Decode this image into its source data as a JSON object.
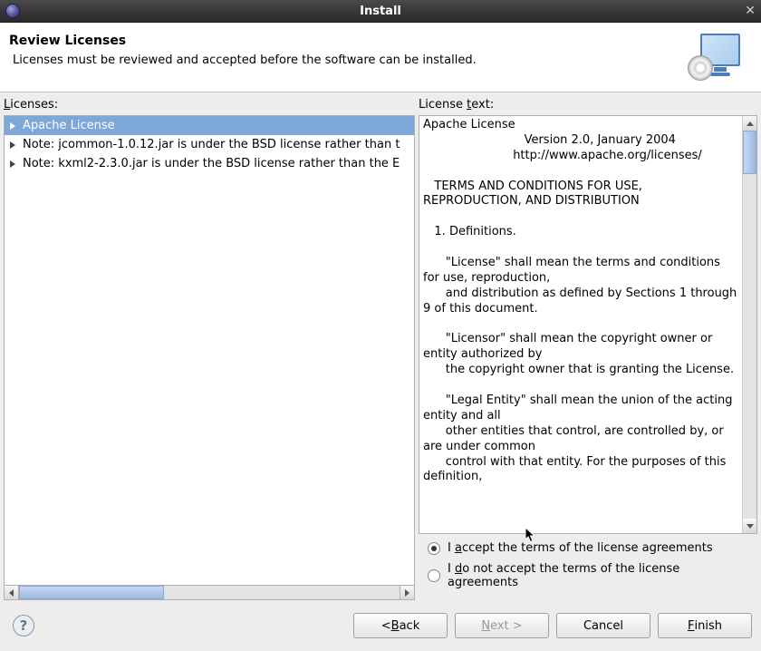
{
  "titlebar": {
    "title": "Install"
  },
  "header": {
    "title": "Review Licenses",
    "subtitle": "Licenses must be reviewed and accepted before the software can be installed."
  },
  "labels": {
    "licenses": "icenses:",
    "licenses_first": "L",
    "license_text": "License ",
    "license_text_u": "t",
    "license_text_rest": "ext:"
  },
  "license_list": [
    {
      "text": "Apache License",
      "selected": true
    },
    {
      "text": "Note:  jcommon-1.0.12.jar is under the BSD license rather than t",
      "selected": false
    },
    {
      "text": "Note:  kxml2-2.3.0.jar is under the BSD license rather than the E",
      "selected": false
    }
  ],
  "license_text": "Apache License\n                           Version 2.0, January 2004\n                        http://www.apache.org/licenses/\n\n   TERMS AND CONDITIONS FOR USE, REPRODUCTION, AND DISTRIBUTION\n\n   1. Definitions.\n\n      \"License\" shall mean the terms and conditions for use, reproduction,\n      and distribution as defined by Sections 1 through 9 of this document.\n\n      \"Licensor\" shall mean the copyright owner or entity authorized by\n      the copyright owner that is granting the License.\n\n      \"Legal Entity\" shall mean the union of the acting entity and all\n      other entities that control, are controlled by, or are under common\n      control with that entity. For the purposes of this definition,",
  "radio": {
    "accept_pre": "I ",
    "accept_u": "a",
    "accept_post": "ccept the terms of the license agreements",
    "reject_pre": "I ",
    "reject_u": "d",
    "reject_post": "o not accept the terms of the license agreements"
  },
  "buttons": {
    "back_pre": "< ",
    "back_u": "B",
    "back_post": "ack",
    "next_u": "N",
    "next_post": "ext >",
    "cancel": "Cancel",
    "finish_u": "F",
    "finish_post": "inish"
  }
}
